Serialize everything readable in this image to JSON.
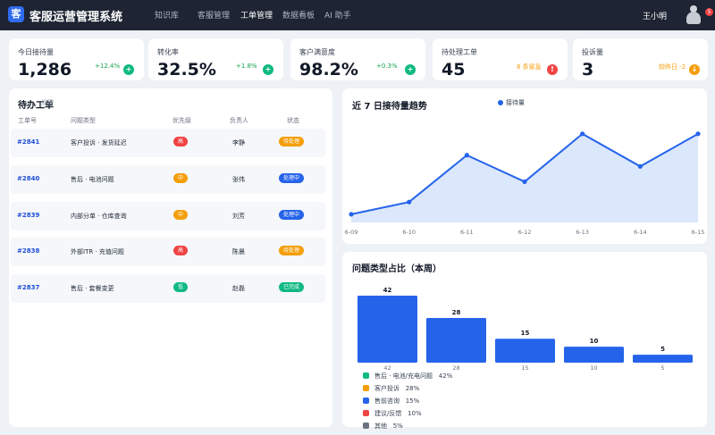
{
  "header": {
    "logo_char": "客",
    "title": "客服运营管理系统",
    "nav": [
      {
        "label": "知识库"
      },
      {
        "label": "客服管理"
      },
      {
        "label": "工单管理"
      },
      {
        "label": "数据看板"
      },
      {
        "label": "AI 助手"
      }
    ],
    "active_nav": 2,
    "username": "王小明",
    "notification_count": "5"
  },
  "stats": [
    {
      "label": "今日接待量",
      "value": "1,286",
      "delta": "+12.4%",
      "delta_color": "#16a34a",
      "icon": "plus-icon",
      "icon_char": "+",
      "icon_color": "#10b981"
    },
    {
      "label": "转化率",
      "value": "32.5%",
      "delta": "+1.8%",
      "delta_color": "#16a34a",
      "icon": "plus-icon",
      "icon_char": "+",
      "icon_color": "#10b981"
    },
    {
      "label": "客户满意度",
      "value": "98.2%",
      "delta": "+0.3%",
      "delta_color": "#16a34a",
      "icon": "plus-icon",
      "icon_char": "+",
      "icon_color": "#10b981"
    },
    {
      "label": "待处理工单",
      "value": "45",
      "delta": "8 条紧急",
      "delta_color": "#f59e0b",
      "icon": "alert-icon",
      "icon_char": "!",
      "icon_color": "#ef4444"
    },
    {
      "label": "投诉量",
      "value": "3",
      "delta": "较昨日 -2",
      "delta_color": "#f59e0b",
      "icon": "trend-down-icon",
      "icon_char": "↓",
      "icon_color": "#f59e0b"
    }
  ],
  "tickets": {
    "title": "待办工单",
    "ghost_text": "处理",
    "columns": [
      "工单号",
      "问题类型",
      "优先级",
      "负责人",
      "状态"
    ],
    "rows": [
      {
        "id": "#2841",
        "type": "客户投诉 · 发货延迟",
        "priority": "高",
        "priority_color": "#ef4444",
        "owner": "李静",
        "status": "待处理",
        "status_color": "#f59e0b"
      },
      {
        "id": "#2840",
        "type": "售后 · 电池问题",
        "priority": "中",
        "priority_color": "#f59e0b",
        "owner": "张伟",
        "status": "处理中",
        "status_color": "#2563eb"
      },
      {
        "id": "#2839",
        "type": "内部分单 · 仓库查询",
        "priority": "中",
        "priority_color": "#f59e0b",
        "owner": "刘芳",
        "status": "处理中",
        "status_color": "#2563eb"
      },
      {
        "id": "#2838",
        "type": "外部ITR · 充值问题",
        "priority": "高",
        "priority_color": "#ef4444",
        "owner": "陈晨",
        "status": "待处理",
        "status_color": "#f59e0b"
      },
      {
        "id": "#2837",
        "type": "售后 · 套餐变更",
        "priority": "低",
        "priority_color": "#10b981",
        "owner": "赵磊",
        "status": "已完成",
        "status_color": "#10b981"
      }
    ]
  },
  "line_panel": {
    "title": "近 7 日接待量趋势"
  },
  "bar_panel": {
    "title": "问题类型占比（本周）"
  },
  "chart_data": [
    {
      "type": "area",
      "title": "近 7 日接待量趋势",
      "x": [
        "6-09",
        "6-10",
        "6-11",
        "6-12",
        "6-13",
        "6-14",
        "6-15"
      ],
      "series": [
        {
          "name": "接待量",
          "values": [
            8,
            20,
            66,
            40,
            87,
            55,
            87
          ]
        }
      ],
      "ylim": [
        0,
        100
      ],
      "color": "#2563eb",
      "fill": "#dbe7fb",
      "grid": false,
      "legend": "top-center"
    },
    {
      "type": "bar",
      "title": "问题类型占比（本周）",
      "categories": [
        "42",
        "28",
        "15",
        "10",
        "5"
      ],
      "values": [
        42,
        28,
        15,
        10,
        5
      ],
      "ylim": [
        0,
        42
      ],
      "color": "#2563eb",
      "legend": "bottom-left",
      "legend_items": [
        {
          "label": "售后 · 电池/充电问题",
          "pct": "42%",
          "color": "#10b981"
        },
        {
          "label": "客户投诉",
          "pct": "28%",
          "color": "#f59e0b"
        },
        {
          "label": "售前咨询",
          "pct": "15%",
          "color": "#2563eb"
        },
        {
          "label": "建议/反馈",
          "pct": "10%",
          "color": "#ef4444"
        },
        {
          "label": "其他",
          "pct": "5%",
          "color": "#6b7280"
        }
      ]
    }
  ]
}
